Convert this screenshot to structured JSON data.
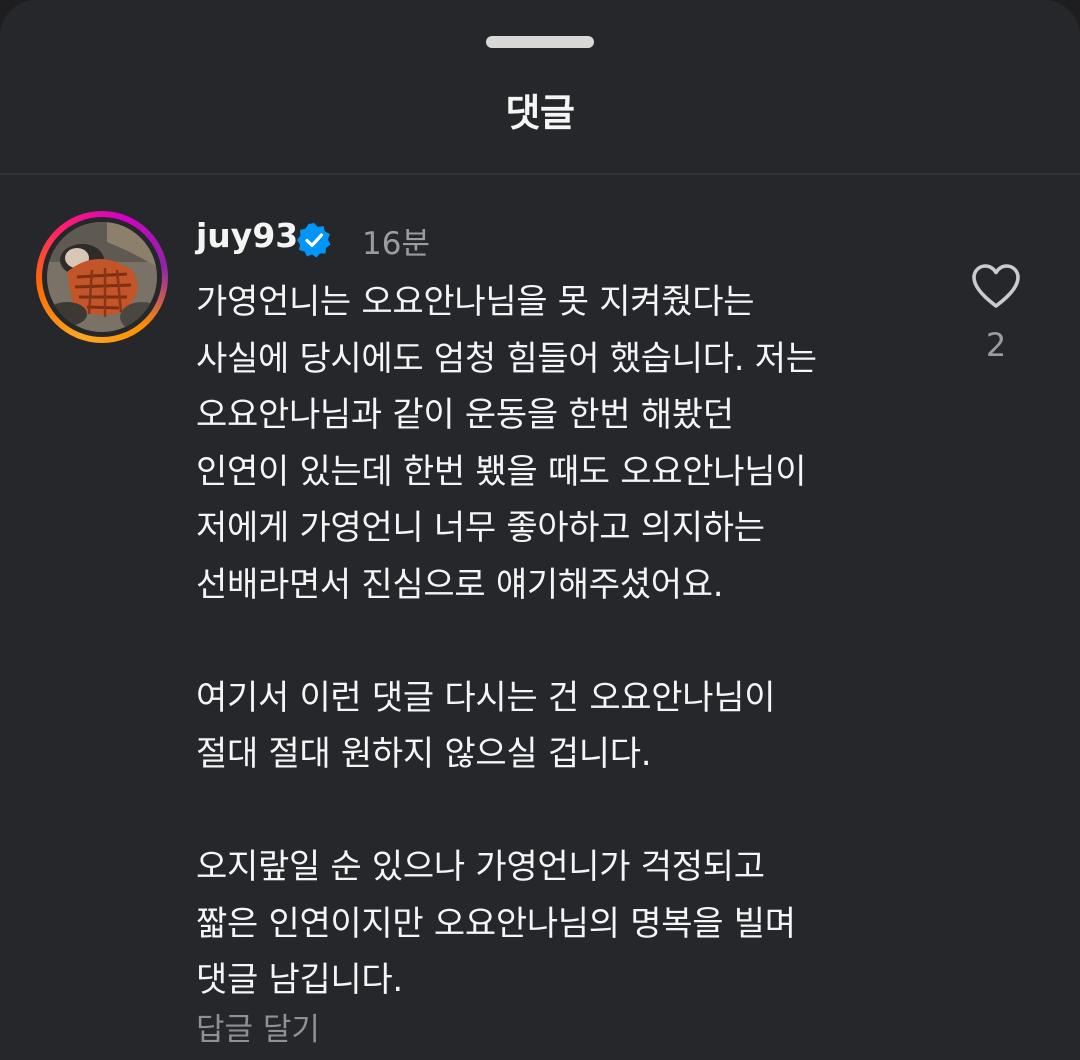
{
  "header": {
    "title": "댓글"
  },
  "comment": {
    "username": "juy93",
    "verified_icon": "verified-badge-icon",
    "time": "16분",
    "paragraphs": [
      [
        "가영언니는 오요안나님을 못 지켜줬다는",
        "사실에 당시에도 엄청 힘들어 했습니다. 저는",
        "오요안나님과 같이 운동을 한번 해봤던",
        "인연이 있는데 한번 뵀을 때도 오요안나님이",
        "저에게 가영언니 너무 좋아하고 의지하는",
        "선배라면서 진심으로 얘기해주셨어요."
      ],
      [
        "여기서 이런 댓글 다시는 건 오요안나님이",
        "절대 절대 원하지 않으실 겁니다."
      ],
      [
        "오지랖일 순 있으나 가영언니가 걱정되고",
        "짧은 인연이지만 오요안나님의 명복을 빌며",
        "댓글 남깁니다."
      ]
    ],
    "reply_label": "답글 달기",
    "like_icon": "heart-outline-icon",
    "like_count": "2"
  },
  "colors": {
    "background": "#25272b",
    "text": "#f3f5f7",
    "muted": "#9a9ca2",
    "verified": "#0095f6"
  }
}
